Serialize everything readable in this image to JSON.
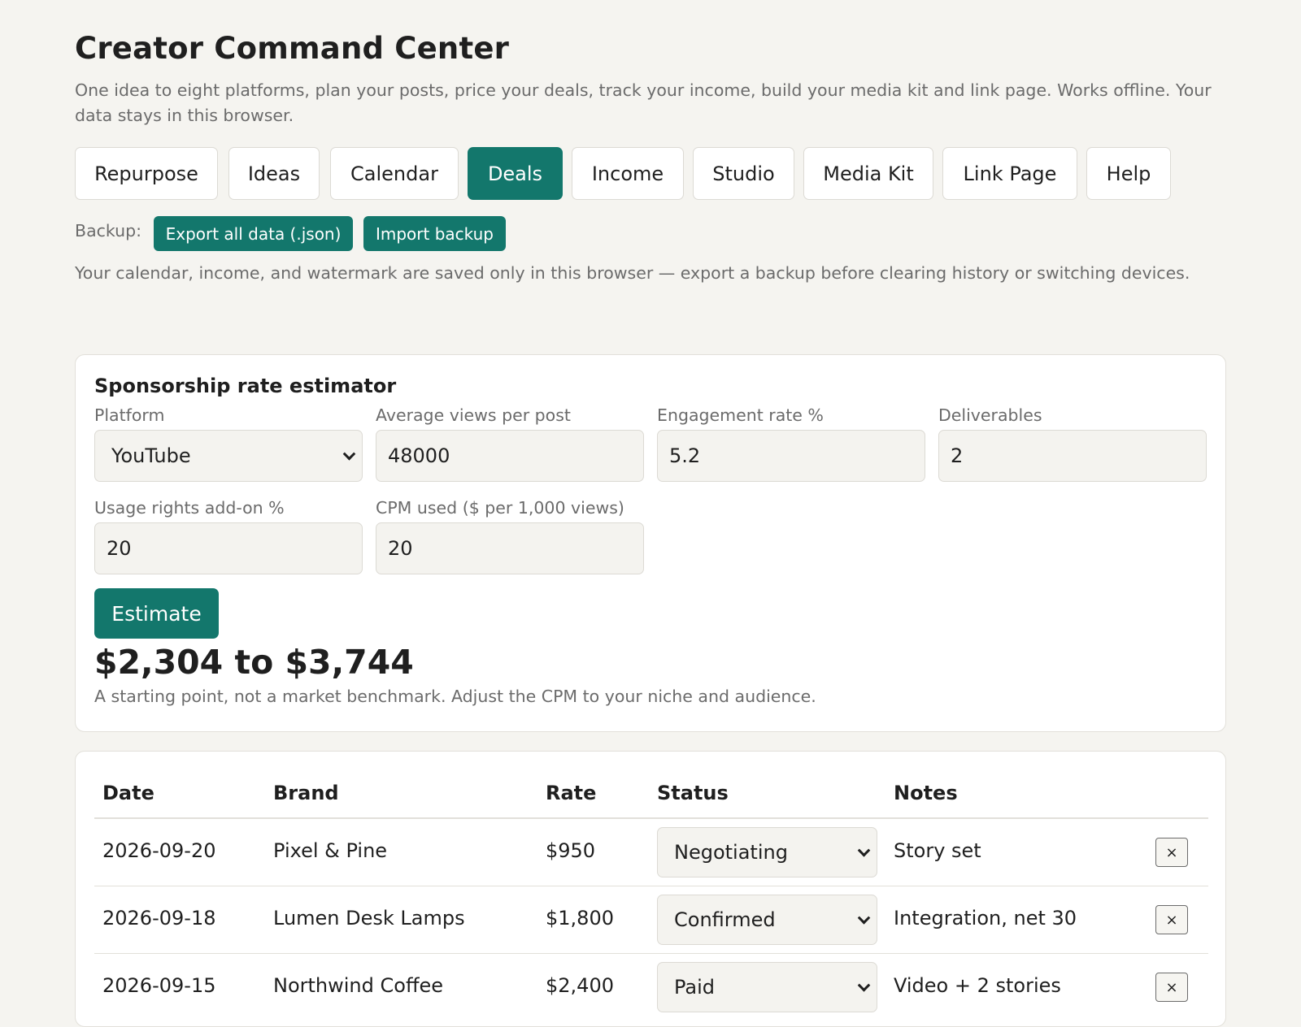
{
  "app": {
    "title": "Creator Command Center",
    "subtitle": "One idea to eight platforms, plan your posts, price your deals, track your income, build your media kit and link page. Works offline. Your data stays in this browser."
  },
  "tabs": [
    {
      "label": "Repurpose",
      "active": false
    },
    {
      "label": "Ideas",
      "active": false
    },
    {
      "label": "Calendar",
      "active": false
    },
    {
      "label": "Deals",
      "active": true
    },
    {
      "label": "Income",
      "active": false
    },
    {
      "label": "Studio",
      "active": false
    },
    {
      "label": "Media Kit",
      "active": false
    },
    {
      "label": "Link Page",
      "active": false
    },
    {
      "label": "Help",
      "active": false
    }
  ],
  "backup": {
    "label": "Backup:",
    "export_label": "Export all data (.json)",
    "import_label": "Import backup",
    "note": "Your calendar, income, and watermark are saved only in this browser — export a backup before clearing history or switching devices."
  },
  "estimator": {
    "title": "Sponsorship rate estimator",
    "platform": {
      "label": "Platform",
      "value": "YouTube"
    },
    "avg_views": {
      "label": "Average views per post",
      "value": "48000"
    },
    "engagement": {
      "label": "Engagement rate %",
      "value": "5.2"
    },
    "deliverables": {
      "label": "Deliverables",
      "value": "2"
    },
    "usage_rights": {
      "label": "Usage rights add-on %",
      "value": "20"
    },
    "cpm": {
      "label": "CPM used ($ per 1,000 views)",
      "value": "20"
    },
    "button_label": "Estimate",
    "result": "$2,304 to $3,744",
    "note": "A starting point, not a market benchmark. Adjust the CPM to your niche and audience."
  },
  "deals": {
    "headers": {
      "date": "Date",
      "brand": "Brand",
      "rate": "Rate",
      "status": "Status",
      "notes": "Notes"
    },
    "rows": [
      {
        "date": "2026-09-20",
        "brand": "Pixel & Pine",
        "rate": "$950",
        "status": "Negotiating",
        "notes": "Story set",
        "delete": "×"
      },
      {
        "date": "2026-09-18",
        "brand": "Lumen Desk Lamps",
        "rate": "$1,800",
        "status": "Confirmed",
        "notes": "Integration, net 30",
        "delete": "×"
      },
      {
        "date": "2026-09-15",
        "brand": "Northwind Coffee",
        "rate": "$2,400",
        "status": "Paid",
        "notes": "Video + 2 stories",
        "delete": "×"
      }
    ]
  },
  "colors": {
    "accent": "#13776c",
    "background": "#f5f4f0",
    "muted_text": "#6b6b6b"
  }
}
